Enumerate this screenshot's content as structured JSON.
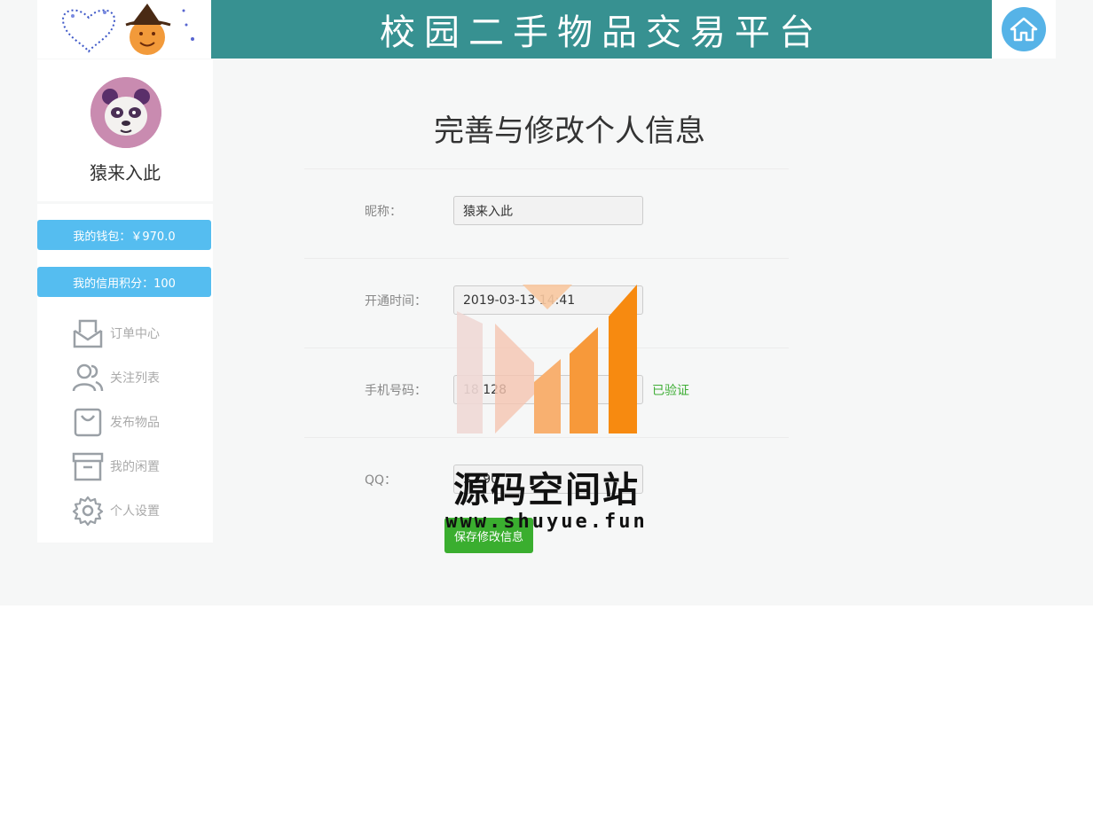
{
  "header": {
    "site_title": "校园二手物品交易平台",
    "home_icon": "home-icon",
    "brand_color": "#379191"
  },
  "profile": {
    "username": "猿来入此",
    "avatar_icon": "panda-avatar"
  },
  "sidebar": {
    "wallet_label": "我的钱包：￥970.0",
    "credit_label": "我的信用积分：100",
    "items": [
      {
        "label": "订单中心",
        "icon": "envelope-icon"
      },
      {
        "label": "关注列表",
        "icon": "users-icon"
      },
      {
        "label": "发布物品",
        "icon": "bag-icon"
      },
      {
        "label": "我的闲置",
        "icon": "archive-box-icon"
      },
      {
        "label": "个人设置",
        "icon": "gear-icon"
      }
    ],
    "button_color": "#55bdf0"
  },
  "main": {
    "title": "完善与修改个人信息",
    "fields": {
      "nickname": {
        "label": "昵称：",
        "value": "猿来入此"
      },
      "open_time": {
        "label": "开通时间：",
        "value": "2019-03-13 14:41"
      },
      "phone": {
        "label": "手机号码：",
        "value": "18 128",
        "status": "已验证"
      },
      "qq": {
        "label": "QQ：",
        "value": "32 90"
      }
    },
    "save_label": "保存修改信息",
    "save_color": "#3aae2f",
    "verified_color": "#3fae36"
  },
  "watermark": {
    "text": "源码空间站",
    "url": "www.shuyue.fun"
  }
}
